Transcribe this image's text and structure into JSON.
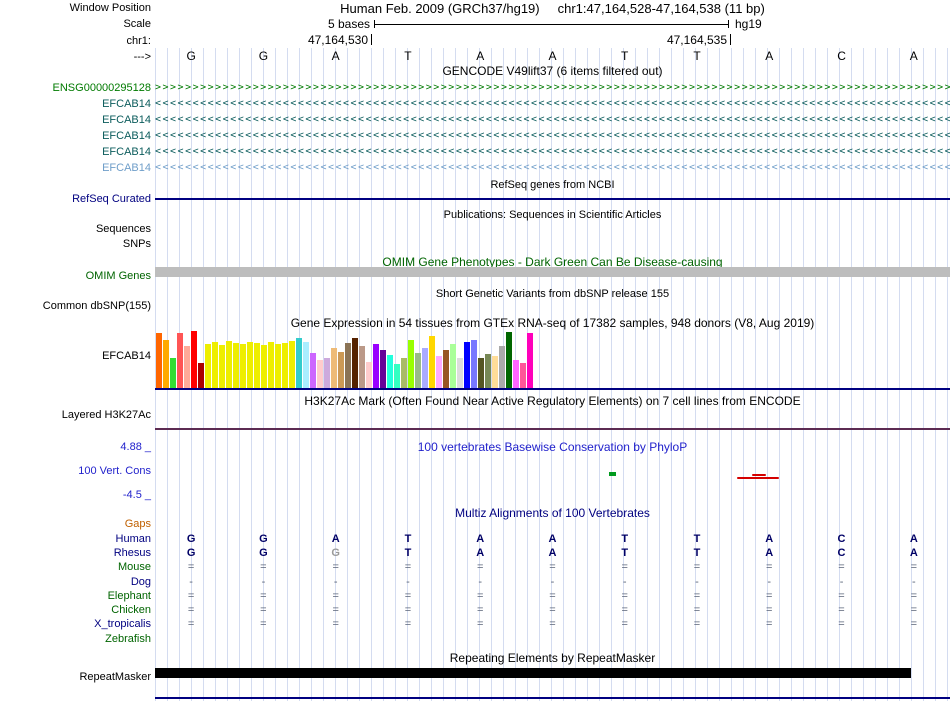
{
  "colors": {
    "grid": "#d4dcf0",
    "navy": "#000080",
    "gene_green": "#007a00",
    "gene_teal": "#0b5c5c",
    "gene_lightblue": "#6f9ec9",
    "omim_green": "#006400",
    "cons_blue": "#2222cc",
    "gaps_orange": "#c06000",
    "h3k27ac_line": "#5c2b52",
    "omim_bar_gray": "#bdbdbd"
  },
  "header": {
    "window_position_label": "Window Position",
    "assembly": "Human Feb. 2009 (GRCh37/hg19)",
    "position": "chr1:47,164,528-47,164,538 (11 bp)",
    "scale_label": "Scale",
    "scale_value": "5 bases",
    "scale_right": "hg19",
    "chrom_label": "chr1:",
    "coord_left": "47,164,530",
    "coord_right": "47,164,535",
    "strand_arrow": "--->"
  },
  "ruler": {
    "bases": [
      "G",
      "G",
      "A",
      "T",
      "A",
      "A",
      "T",
      "T",
      "A",
      "C",
      "A"
    ]
  },
  "gencode": {
    "title": "GENCODE V49lift37 (6 items filtered out)",
    "items": [
      {
        "label": "ENSG00000295128",
        "color": "#007a00",
        "arrow": ">"
      },
      {
        "label": "EFCAB14",
        "color": "#0b5c5c",
        "arrow": "<"
      },
      {
        "label": "EFCAB14",
        "color": "#0b5c5c",
        "arrow": "<"
      },
      {
        "label": "EFCAB14",
        "color": "#0b5c5c",
        "arrow": "<"
      },
      {
        "label": "EFCAB14",
        "color": "#0b5c5c",
        "arrow": "<"
      },
      {
        "label": "EFCAB14",
        "color": "#6f9ec9",
        "arrow": "<"
      }
    ]
  },
  "refseq": {
    "title": "RefSeq genes from NCBI",
    "label": "RefSeq Curated"
  },
  "publications": {
    "title": "Publications: Sequences in Scientific Articles",
    "sequences_label": "Sequences",
    "snps_label": "SNPs"
  },
  "omim": {
    "title": "OMIM Gene Phenotypes - Dark Green Can Be Disease-causing",
    "label": "OMIM Genes"
  },
  "dbsnp": {
    "title": "Short Genetic Variants from dbSNP release 155",
    "label": "Common dbSNP(155)"
  },
  "h3k27ac": {
    "title": "H3K27Ac Mark (Often Found Near Active Regulatory Elements) on 7 cell lines from ENCODE",
    "label": "Layered H3K27Ac"
  },
  "conservation": {
    "title": "100 vertebrates Basewise Conservation by PhyloP",
    "label": "100 Vert. Cons",
    "max": "4.88 _",
    "min": "-4.5 _"
  },
  "multiz": {
    "title": "Multiz Alignments of 100 Vertebrates",
    "gaps_label": "Gaps",
    "rows": [
      {
        "name": "Human",
        "color": "#000080",
        "cells": [
          "G",
          "G",
          "A",
          "T",
          "A",
          "A",
          "T",
          "T",
          "A",
          "C",
          "A"
        ]
      },
      {
        "name": "Rhesus",
        "color": "#000080",
        "cells": [
          "G",
          "G",
          "G",
          "T",
          "A",
          "A",
          "T",
          "T",
          "A",
          "C",
          "A"
        ],
        "gray_cols": [
          2
        ]
      },
      {
        "name": "Mouse",
        "color": "#006400",
        "cells": [
          "=",
          "=",
          "=",
          "=",
          "=",
          "=",
          "=",
          "=",
          "=",
          "=",
          "="
        ]
      },
      {
        "name": "Dog",
        "color": "#000080",
        "cells": [
          "-",
          "-",
          "-",
          "-",
          "-",
          "-",
          "-",
          "-",
          "-",
          "-",
          "-"
        ]
      },
      {
        "name": "Elephant",
        "color": "#006400",
        "cells": [
          "=",
          "=",
          "=",
          "=",
          "=",
          "=",
          "=",
          "=",
          "=",
          "=",
          "="
        ]
      },
      {
        "name": "Chicken",
        "color": "#006400",
        "cells": [
          "=",
          "=",
          "=",
          "=",
          "=",
          "=",
          "=",
          "=",
          "=",
          "=",
          "="
        ]
      },
      {
        "name": "X_tropicalis",
        "color": "#000080",
        "cells": [
          "=",
          "=",
          "=",
          "=",
          "=",
          "=",
          "=",
          "=",
          "=",
          "=",
          "="
        ]
      },
      {
        "name": "Zebrafish",
        "color": "#006400",
        "cells": [
          "",
          "",
          "",
          "",
          "",
          "",
          "",
          "",
          "",
          "",
          ""
        ]
      }
    ]
  },
  "repeatmasker": {
    "title": "Repeating Elements by RepeatMasker",
    "label": "RepeatMasker"
  },
  "chart_data": {
    "type": "bar",
    "title": "Gene Expression in 54 tissues from GTEx RNA-seq of 17382 samples, 948 donors (V8, Aug 2019)",
    "gene": "EFCAB14",
    "n_bars": 54,
    "note": "54 GTEx tissue bars; no numeric axis shown, values are relative bar heights (px)",
    "values": [
      55,
      48,
      30,
      55,
      42,
      57,
      25,
      44,
      46,
      43,
      47,
      45,
      44,
      46,
      45,
      43,
      46,
      44,
      45,
      47,
      50,
      46,
      35,
      28,
      30,
      40,
      36,
      45,
      50,
      42,
      26,
      44,
      38,
      33,
      24,
      30,
      48,
      35,
      40,
      52,
      32,
      38,
      44,
      30,
      46,
      48,
      30,
      34,
      32,
      42,
      56,
      28,
      25,
      55
    ],
    "colors": [
      "#FF6600",
      "#FFAA00",
      "#33DD33",
      "#FF5555",
      "#FFAA99",
      "#FF0000",
      "#AA0000",
      "#EEEE00",
      "#EEEE00",
      "#EEEE00",
      "#EEEE00",
      "#EEEE00",
      "#EEEE00",
      "#EEEE00",
      "#EEEE00",
      "#EEEE00",
      "#EEEE00",
      "#EEEE00",
      "#EEEE00",
      "#EEEE00",
      "#33CCCC",
      "#AAEEFF",
      "#CC66FF",
      "#FFCCCC",
      "#CCAADD",
      "#EEBB77",
      "#CC9955",
      "#8B7355",
      "#552200",
      "#BB9988",
      "#FFCCCC",
      "#9900FF",
      "#660099",
      "#22FFDD",
      "#33FFC2",
      "#AABB66",
      "#99FF00",
      "#99BB88",
      "#AAAAFF",
      "#FFD700",
      "#FFAAFF",
      "#995522",
      "#AAFF99",
      "#DDDDDD",
      "#0000FF",
      "#7777FF",
      "#555522",
      "#778855",
      "#FFDD99",
      "#AAAAAA",
      "#006600",
      "#FF66FF",
      "#FF5599",
      "#FF00BB"
    ]
  }
}
